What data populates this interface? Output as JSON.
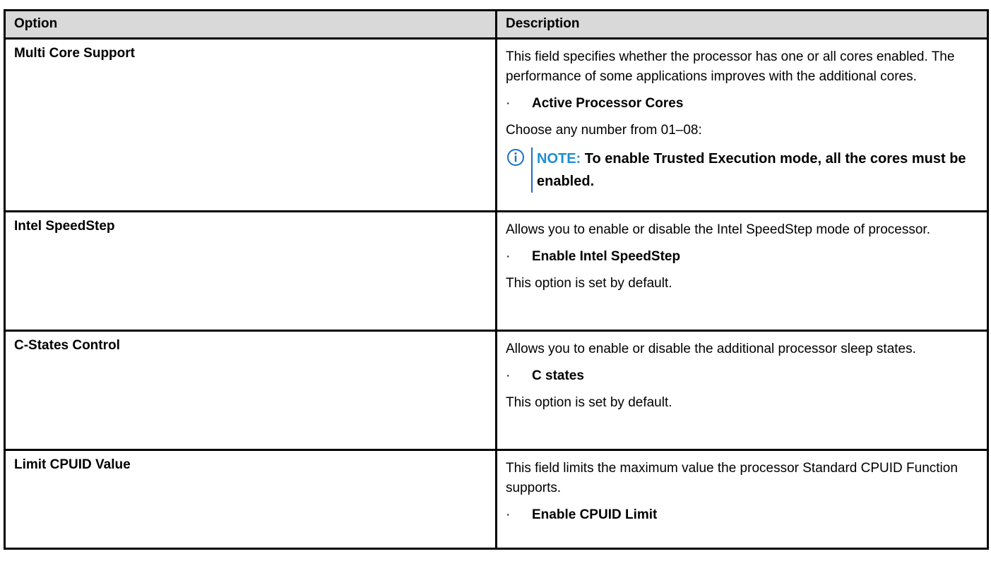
{
  "table": {
    "headers": {
      "option": "Option",
      "description": "Description"
    },
    "rows": [
      {
        "option": "Multi Core Support",
        "desc_intro": "This field specifies whether the processor has one or all cores enabled. The performance of some applications improves with the additional cores.",
        "bullet": "Active Processor Cores",
        "after": "Choose any number from 01–08:",
        "note_label": "NOTE:",
        "note_text": "To enable Trusted Execution mode, all the cores must be enabled."
      },
      {
        "option": "Intel SpeedStep",
        "desc_intro": "Allows you to enable or disable the Intel SpeedStep mode of processor.",
        "bullet": "Enable Intel SpeedStep",
        "after": "This option is set by default."
      },
      {
        "option": "C-States Control",
        "desc_intro": "Allows you to enable or disable the additional processor sleep states.",
        "bullet": "C states",
        "after": "This option is set by default."
      },
      {
        "option": "Limit CPUID Value",
        "desc_intro": "This field limits the maximum value the processor Standard CPUID Function supports.",
        "bullet": "Enable CPUID Limit"
      }
    ],
    "bullet_glyph": "·"
  },
  "colors": {
    "header_bg": "#d9d9d9",
    "border": "#000000",
    "note_accent": "#1a8fd4"
  },
  "icons": {
    "note": "info-circle-icon"
  }
}
